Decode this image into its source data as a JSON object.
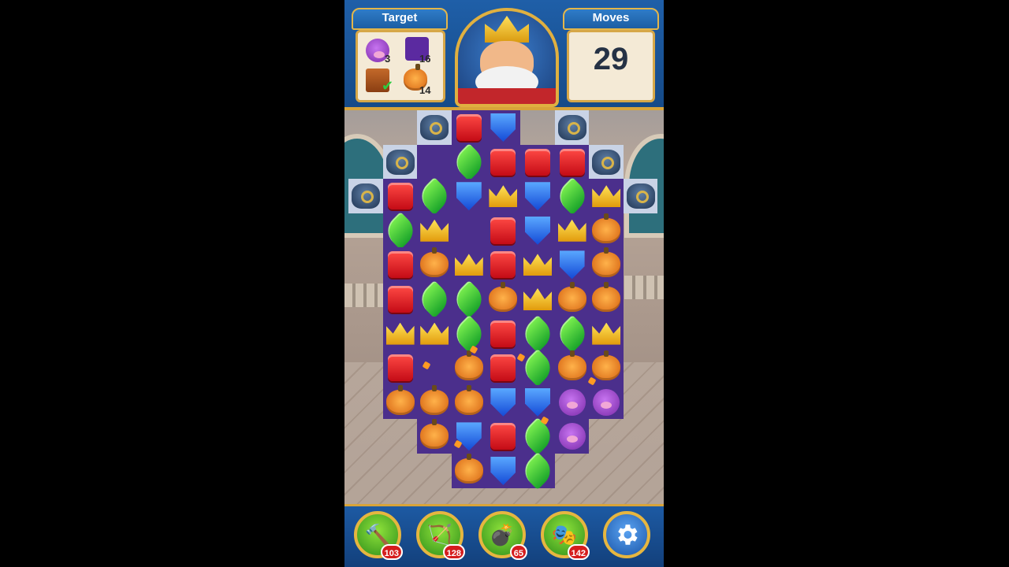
{
  "hud": {
    "target_title": "Target",
    "moves_title": "Moves",
    "moves_left": "29",
    "targets": [
      {
        "name": "pig",
        "count": "3",
        "icon": "pig-icon"
      },
      {
        "name": "purple-tile",
        "count": "16",
        "icon": "purple-square-icon"
      },
      {
        "name": "wood-crate",
        "count": "",
        "icon": "crate-icon",
        "completed": true
      },
      {
        "name": "pumpkin",
        "count": "14",
        "icon": "pumpkin-icon"
      }
    ]
  },
  "boosters": [
    {
      "name": "hammer",
      "icon": "hammer-icon",
      "count": "103"
    },
    {
      "name": "arrow",
      "icon": "bow-arrow-icon",
      "count": "128"
    },
    {
      "name": "cannon",
      "icon": "cannon-icon",
      "count": "65"
    },
    {
      "name": "jester",
      "icon": "jester-hat-icon",
      "count": "142"
    }
  ],
  "settings_icon": "gear-icon",
  "colors": {
    "hud_blue": "#1f5fa8",
    "gold_trim": "#d8a43a",
    "board_purple": "#4b2f8c"
  },
  "board": {
    "rows": [
      [
        "",
        "",
        "pot",
        "red",
        "shield",
        "",
        "pot",
        "",
        ""
      ],
      [
        "",
        "pot",
        "",
        "leaf",
        "red",
        "red",
        "red",
        "pot",
        ""
      ],
      [
        "pot",
        "red",
        "leaf",
        "shield",
        "crown",
        "shield",
        "leaf",
        "crown",
        "pot"
      ],
      [
        "",
        "leaf",
        "crown",
        "",
        "red",
        "shield",
        "crown",
        "pumpkin",
        ""
      ],
      [
        "",
        "red",
        "pumpkin",
        "crown",
        "red",
        "crown",
        "shield",
        "pumpkin",
        ""
      ],
      [
        "",
        "red",
        "leaf",
        "leaf",
        "pumpkin",
        "crown",
        "pumpkin",
        "pumpkin",
        ""
      ],
      [
        "",
        "crown",
        "crown",
        "leaf",
        "red",
        "leaf",
        "leaf",
        "crown",
        ""
      ],
      [
        "",
        "red",
        "",
        "pumpkin",
        "red",
        "leaf",
        "pumpkin",
        "pumpkin",
        ""
      ],
      [
        "",
        "pumpkin",
        "pumpkin",
        "pumpkin",
        "shield",
        "shield",
        "pig",
        "pig",
        ""
      ],
      [
        "",
        "",
        "pumpkin",
        "shield",
        "red",
        "leaf",
        "pig",
        "",
        ""
      ],
      [
        "",
        "",
        "",
        "pumpkin",
        "shield",
        "leaf",
        "",
        "",
        ""
      ]
    ]
  }
}
